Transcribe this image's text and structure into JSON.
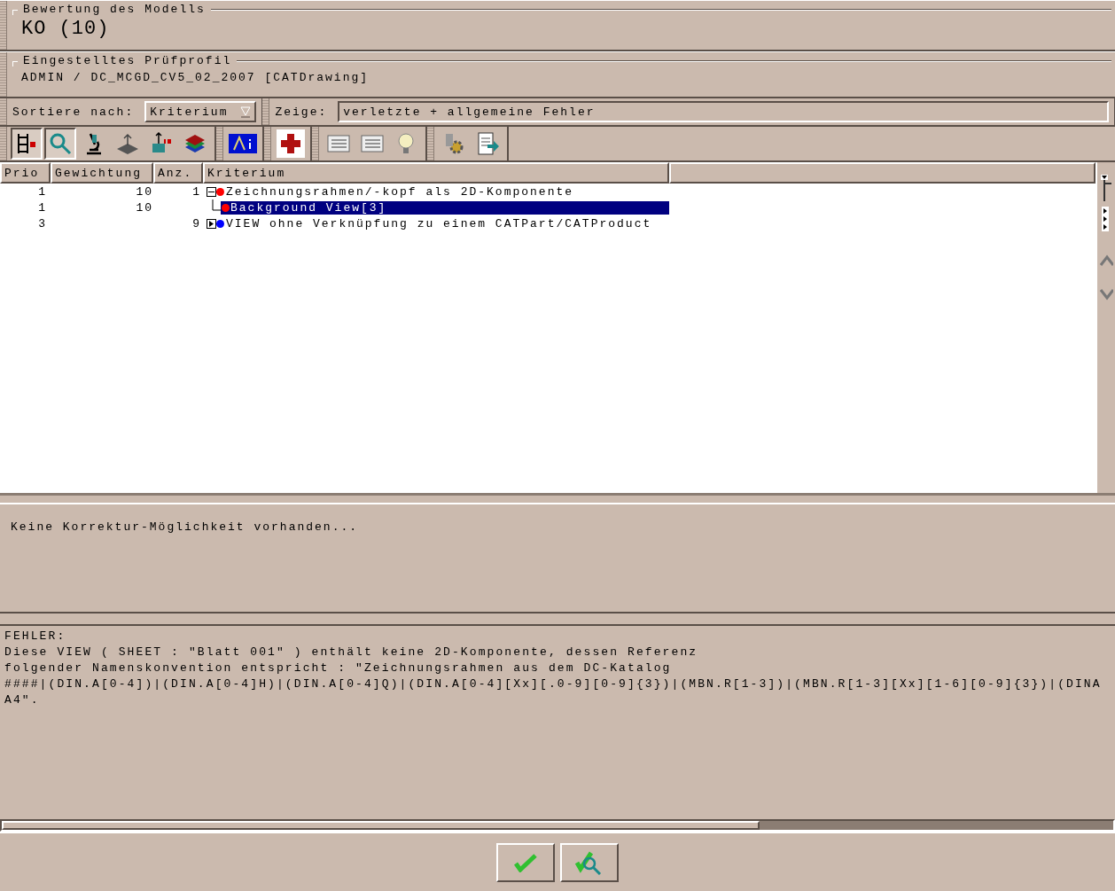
{
  "evaluation": {
    "title": "Bewertung des Modells",
    "value": "KO (10)"
  },
  "profile": {
    "title": "Eingestelltes Prüfprofil",
    "value": "ADMIN / DC_MCGD_CV5_02_2007 [CATDrawing]"
  },
  "filters": [
    {
      "kind": "dropdown",
      "label": "Sortiere nach:",
      "value": "Kriterium"
    },
    {
      "kind": "field",
      "label": "Zeige:",
      "value": "verletzte + allgemeine Fehler"
    }
  ],
  "toolbar": [
    [
      {
        "kind": "tree",
        "selected": true
      },
      {
        "kind": "search",
        "selected": true
      },
      {
        "kind": "microscope",
        "selected": false
      },
      {
        "kind": "plane",
        "selected": false
      },
      {
        "kind": "measure",
        "selected": false
      },
      {
        "kind": "layers",
        "selected": false
      }
    ],
    [
      {
        "kind": "info",
        "selected": false
      }
    ],
    [
      {
        "kind": "plus",
        "selected": false
      }
    ],
    [
      {
        "kind": "list",
        "selected": false
      },
      {
        "kind": "list",
        "selected": false
      },
      {
        "kind": "bulb",
        "selected": false
      }
    ],
    [
      {
        "kind": "gear",
        "selected": false
      },
      {
        "kind": "export",
        "selected": false
      }
    ]
  ],
  "table": {
    "columns": [
      "Prio",
      "Gewichtung",
      "Anz.",
      "Kriterium"
    ],
    "rows": [
      {
        "prio": "1",
        "weight": "10",
        "count": "1",
        "label": "Zeichnungsrahmen/-kopf als 2D-Komponente",
        "color": "#ff0000",
        "expanded": true,
        "selected": false,
        "children": [
          {
            "prio": "1",
            "weight": "10",
            "label": "Background View[3]",
            "color": "#ff0000",
            "selected": true
          }
        ]
      },
      {
        "prio": "3",
        "count": "9",
        "label": "VIEW ohne Verknüpfung zu einem CATPart/CATProduct",
        "color": "#0000ff",
        "expanded": false,
        "selected": false
      }
    ]
  },
  "correction_message": "Keine Korrektur-Möglichkeit vorhanden...",
  "error_text": [
    "FEHLER:",
    "Diese VIEW ( SHEET : \"Blatt 001\" ) enthält keine 2D-Komponente, dessen Referenz",
    "folgender Namenskonvention entspricht : \"Zeichnungsrahmen aus dem DC-Katalog",
    "####|(DIN.A[0-4])|(DIN.A[0-4]H)|(DIN.A[0-4]Q)|(DIN.A[0-4][Xx][.0-9][0-9]{3})|(MBN.R[1-3])|(MBN.R[1-3][Xx][1-6][0-9]{3})|(DINA",
    "A4\"."
  ],
  "buttons": [
    {
      "kind": "confirm"
    },
    {
      "kind": "check"
    }
  ]
}
